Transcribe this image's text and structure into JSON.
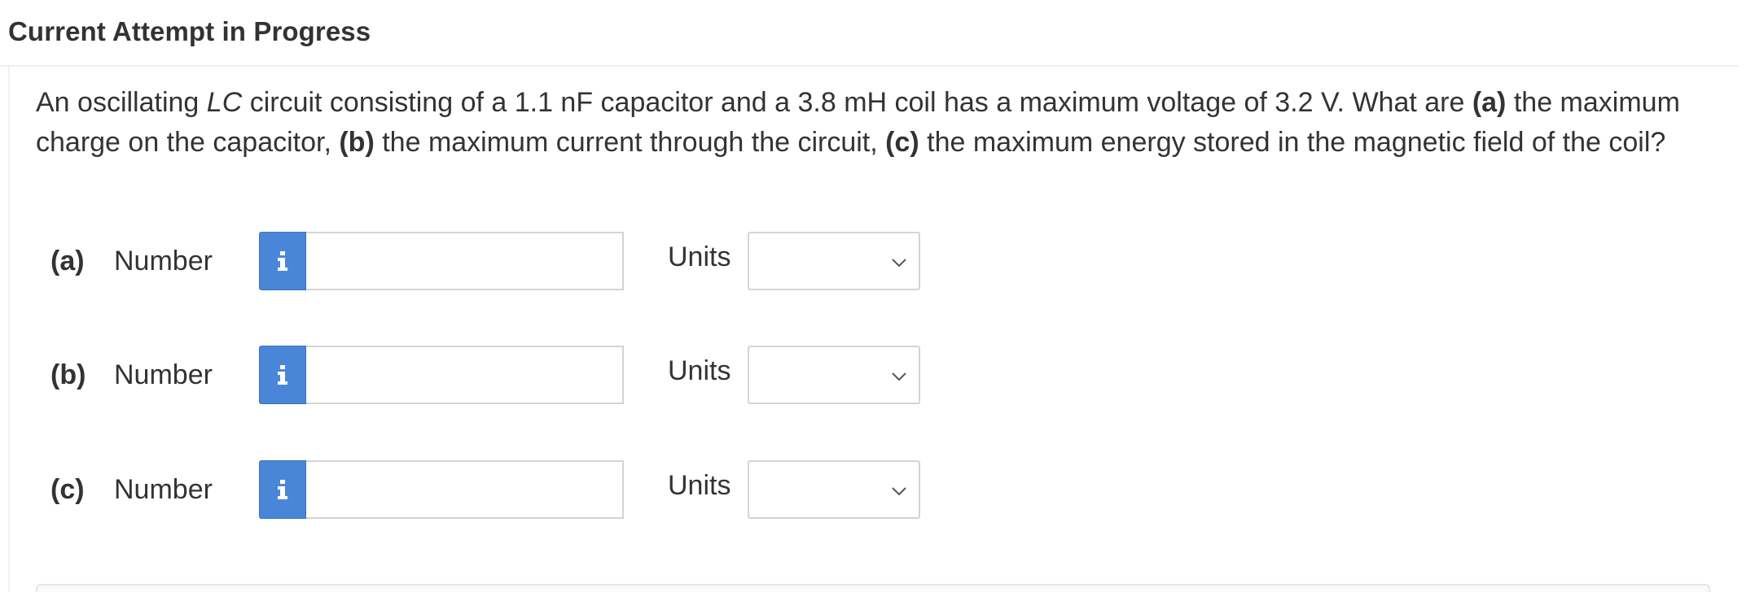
{
  "header": {
    "title": "Current Attempt in Progress"
  },
  "question": {
    "t1": "An oscillating ",
    "t2": "LC",
    "t3": " circuit consisting of a 1.1 nF capacitor and a 3.8 mH coil has a maximum voltage of 3.2 V. What are ",
    "t4": "(a)",
    "t5": " the maximum charge on the capacitor, ",
    "t6": "(b)",
    "t7": " the maximum current through the circuit, ",
    "t8": "(c)",
    "t9": " the maximum energy stored in the magnetic field of the coil?"
  },
  "parts": [
    {
      "part": "(a)",
      "number_label": "Number",
      "number_value": "",
      "units_label": "Units",
      "units_value": ""
    },
    {
      "part": "(b)",
      "number_label": "Number",
      "number_value": "",
      "units_label": "Units",
      "units_value": ""
    },
    {
      "part": "(c)",
      "number_label": "Number",
      "number_value": "",
      "units_label": "Units",
      "units_value": ""
    }
  ],
  "icons": {
    "info": "info-icon",
    "dropdown": "chevron-down-icon"
  },
  "colors": {
    "info_button": "#4a86d8",
    "text": "#333333",
    "border": "#d4d4d4"
  }
}
